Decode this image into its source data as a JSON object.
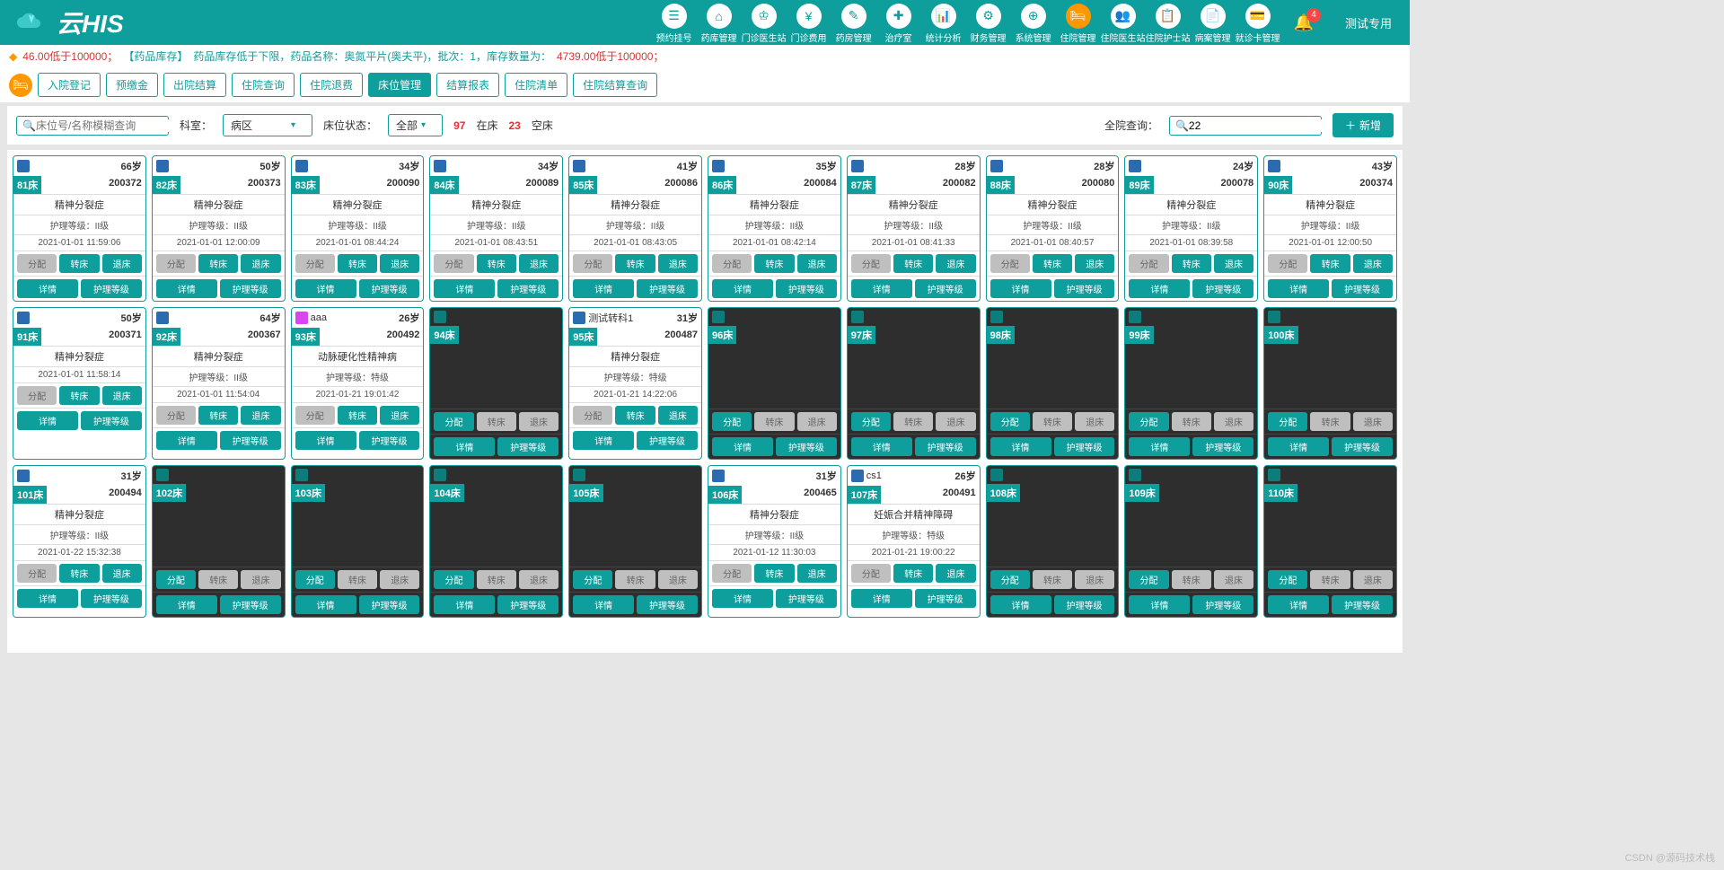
{
  "brand": "云HIS",
  "user": "测试专用",
  "notif_count": "4",
  "nav": [
    {
      "lbl": "预约挂号",
      "ico": "☰"
    },
    {
      "lbl": "药库管理",
      "ico": "⌂"
    },
    {
      "lbl": "门诊医生站",
      "ico": "♔"
    },
    {
      "lbl": "门诊费用",
      "ico": "¥"
    },
    {
      "lbl": "药房管理",
      "ico": "✎"
    },
    {
      "lbl": "治疗室",
      "ico": "✚"
    },
    {
      "lbl": "统计分析",
      "ico": "📊"
    },
    {
      "lbl": "财务管理",
      "ico": "⚙"
    },
    {
      "lbl": "系统管理",
      "ico": "⊕"
    },
    {
      "lbl": "住院管理",
      "ico": "🛏",
      "active": true
    },
    {
      "lbl": "住院医生站",
      "ico": "👥"
    },
    {
      "lbl": "住院护士站",
      "ico": "📋"
    },
    {
      "lbl": "病案管理",
      "ico": "📄"
    },
    {
      "lbl": "就诊卡管理",
      "ico": "💳"
    }
  ],
  "alert": {
    "v1": "46.00低于100000；",
    "tag": "【药品库存】",
    "txt": "药品库存低于下限，药品名称：奥氮平片(奥夫平)，批次：1，库存数量为：",
    "v2": "4739.00低于100000；"
  },
  "subnav": [
    "入院登记",
    "预缴金",
    "出院结算",
    "住院查询",
    "住院退费",
    "床位管理",
    "结算报表",
    "住院清单",
    "住院结算查询"
  ],
  "subnav_active": 5,
  "filter": {
    "search_ph": "床位号/名称模糊查询",
    "dept_lbl": "科室：",
    "dept_val": "病区",
    "stat_lbl": "床位状态：",
    "stat_val": "全部",
    "in_cnt": "97",
    "in_lbl": "在床",
    "empty_cnt": "23",
    "empty_lbl": "空床",
    "global_lbl": "全院查询：",
    "global_val": "22",
    "add": "新增"
  },
  "btns": {
    "a": "分配",
    "b": "转床",
    "c": "退床",
    "d": "详情",
    "e": "护理等级"
  },
  "cards": [
    {
      "bed": "81床",
      "age": "66岁",
      "pid": "200372",
      "diag": "精神分裂症",
      "nurse": "护理等级：II级",
      "time": "2021-01-01 11:59:06",
      "g1": true
    },
    {
      "bed": "82床",
      "age": "50岁",
      "pid": "200373",
      "diag": "精神分裂症",
      "nurse": "护理等级：II级",
      "time": "2021-01-01 12:00:09",
      "g1": true
    },
    {
      "bed": "83床",
      "age": "34岁",
      "pid": "200090",
      "diag": "精神分裂症",
      "nurse": "护理等级：II级",
      "time": "2021-01-01 08:44:24",
      "g1": true
    },
    {
      "bed": "84床",
      "age": "34岁",
      "pid": "200089",
      "diag": "精神分裂症",
      "nurse": "护理等级：II级",
      "time": "2021-01-01 08:43:51",
      "g1": true
    },
    {
      "bed": "85床",
      "age": "41岁",
      "pid": "200086",
      "diag": "精神分裂症",
      "nurse": "护理等级：II级",
      "time": "2021-01-01 08:43:05",
      "g1": true
    },
    {
      "bed": "86床",
      "age": "35岁",
      "pid": "200084",
      "diag": "精神分裂症",
      "nurse": "护理等级：II级",
      "time": "2021-01-01 08:42:14",
      "g1": true
    },
    {
      "bed": "87床",
      "age": "28岁",
      "pid": "200082",
      "diag": "精神分裂症",
      "nurse": "护理等级：II级",
      "time": "2021-01-01 08:41:33",
      "g1": true
    },
    {
      "bed": "88床",
      "age": "28岁",
      "pid": "200080",
      "diag": "精神分裂症",
      "nurse": "护理等级：II级",
      "time": "2021-01-01 08:40:57",
      "g1": true
    },
    {
      "bed": "89床",
      "age": "24岁",
      "pid": "200078",
      "diag": "精神分裂症",
      "nurse": "护理等级：II级",
      "time": "2021-01-01 08:39:58",
      "g1": true
    },
    {
      "bed": "90床",
      "age": "43岁",
      "pid": "200374",
      "diag": "精神分裂症",
      "nurse": "护理等级：II级",
      "time": "2021-01-01 12:00:50",
      "g1": true
    },
    {
      "bed": "91床",
      "age": "50岁",
      "pid": "200371",
      "diag": "精神分裂症",
      "nurse": "",
      "time": "2021-01-01 11:58:14",
      "g1": true
    },
    {
      "bed": "92床",
      "age": "64岁",
      "pid": "200367",
      "diag": "精神分裂症",
      "nurse": "护理等级：II级",
      "time": "2021-01-01 11:54:04",
      "g1": true
    },
    {
      "bed": "93床",
      "age": "26岁",
      "pid": "200492",
      "diag": "动脉硬化性精神病",
      "nurse": "护理等级：特级",
      "time": "2021-01-21 19:01:42",
      "name": "aaa",
      "f": true,
      "g1": true
    },
    {
      "bed": "94床",
      "empty": true
    },
    {
      "bed": "95床",
      "age": "31岁",
      "pid": "200487",
      "diag": "精神分裂症",
      "nurse": "护理等级：特级",
      "time": "2021-01-21 14:22:06",
      "name": "测试转科1",
      "g1": true
    },
    {
      "bed": "96床",
      "empty": true
    },
    {
      "bed": "97床",
      "empty": true
    },
    {
      "bed": "98床",
      "empty": true
    },
    {
      "bed": "99床",
      "empty": true
    },
    {
      "bed": "100床",
      "empty": true
    },
    {
      "bed": "101床",
      "age": "31岁",
      "pid": "200494",
      "diag": "精神分裂症",
      "nurse": "护理等级：II级",
      "time": "2021-01-22 15:32:38",
      "g1": true
    },
    {
      "bed": "102床",
      "empty": true
    },
    {
      "bed": "103床",
      "empty": true
    },
    {
      "bed": "104床",
      "empty": true
    },
    {
      "bed": "105床",
      "empty": true
    },
    {
      "bed": "106床",
      "age": "31岁",
      "pid": "200465",
      "diag": "精神分裂症",
      "nurse": "护理等级：II级",
      "time": "2021-01-12 11:30:03",
      "g1": true
    },
    {
      "bed": "107床",
      "age": "26岁",
      "pid": "200491",
      "diag": "妊娠合并精神障碍",
      "nurse": "护理等级：特级",
      "time": "2021-01-21 19:00:22",
      "name": "cs1",
      "g1": true
    },
    {
      "bed": "108床",
      "empty": true
    },
    {
      "bed": "109床",
      "empty": true
    },
    {
      "bed": "110床",
      "empty": true
    }
  ],
  "watermark": "CSDN @源码技术栈"
}
